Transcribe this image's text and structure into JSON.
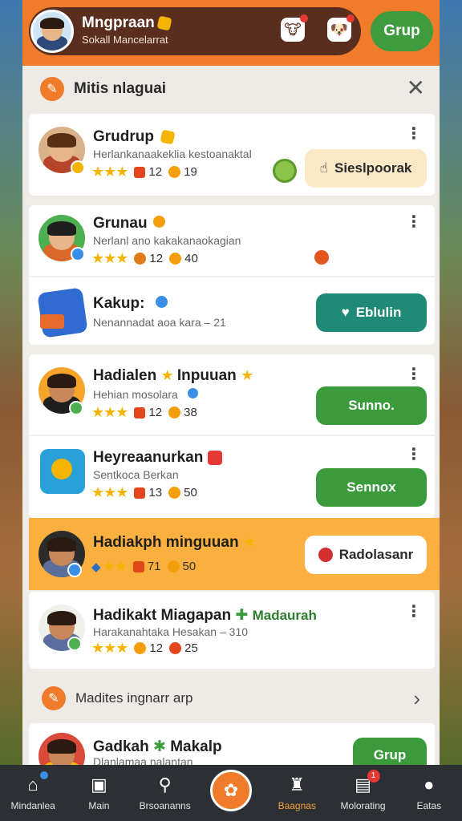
{
  "header": {
    "user_name": "Mngpraan",
    "user_subtitle": "Sokall Mancelarrat",
    "group_button": "Grup",
    "icons": [
      "cow-icon",
      "dog-icon"
    ]
  },
  "section": {
    "title": "Mitis nlaguai",
    "more_title": "Madites ingnarr arp"
  },
  "rows": [
    {
      "title": "Grudrup",
      "subtitle": "Herlankanaakeklia kestoanaktal",
      "stars": "★★★",
      "gem_count": "12",
      "coin_count": "19",
      "button": "Sieslpoorak"
    },
    {
      "title": "Grunau",
      "subtitle": "Nerlanl ano kakakanaokagian",
      "stars": "★★★",
      "gem_count": "12",
      "coin_count": "40"
    },
    {
      "title": "Kakup:",
      "subtitle": "Nenannadat aoa kara – 21",
      "button": "Eblulin"
    },
    {
      "title": "Hadialen",
      "title_extra": "Inpuuan",
      "subtitle": "Hehian mosolara",
      "stars": "★★★",
      "gem_count": "12",
      "coin_count": "38",
      "button": "Sunno."
    },
    {
      "title": "Heyreaanurkan",
      "subtitle": "Sentkoca Berkan",
      "stars": "★★★",
      "gem_count": "13",
      "coin_count": "50",
      "button": "Sennox"
    },
    {
      "title": "Hadiakph minguuan",
      "stars": "★★",
      "gem_count": "71",
      "coin_count": "50",
      "button": "Radolasanr"
    },
    {
      "title": "Hadikakt Miagapan",
      "title_extra": "Madaurah",
      "subtitle": "Harakanahtaka Hesakan – 310",
      "stars": "★★★",
      "gem_count": "12",
      "coin_count": "25"
    },
    {
      "title": "Gadkah",
      "title_extra": "Makalp",
      "subtitle": "Dlanlamaa nalantan",
      "button": "Grup"
    }
  ],
  "nav": [
    {
      "label": "Mindanlea",
      "icon": "home-icon"
    },
    {
      "label": "Main",
      "icon": "chat-icon"
    },
    {
      "label": "Brsoananns",
      "icon": "search-icon"
    },
    {
      "label": "",
      "icon": "center-action-icon"
    },
    {
      "label": "Baagnas",
      "icon": "shop-icon",
      "active": true
    },
    {
      "label": "Molorating",
      "icon": "notification-icon",
      "badge": "1"
    },
    {
      "label": "Eatas",
      "icon": "profile-icon"
    }
  ],
  "colors": {
    "accent": "#f07b2a",
    "header_pill": "#5a2e1e",
    "green": "#3b9a3b",
    "teal": "#1f8a76",
    "highlight": "#f9b03f"
  }
}
